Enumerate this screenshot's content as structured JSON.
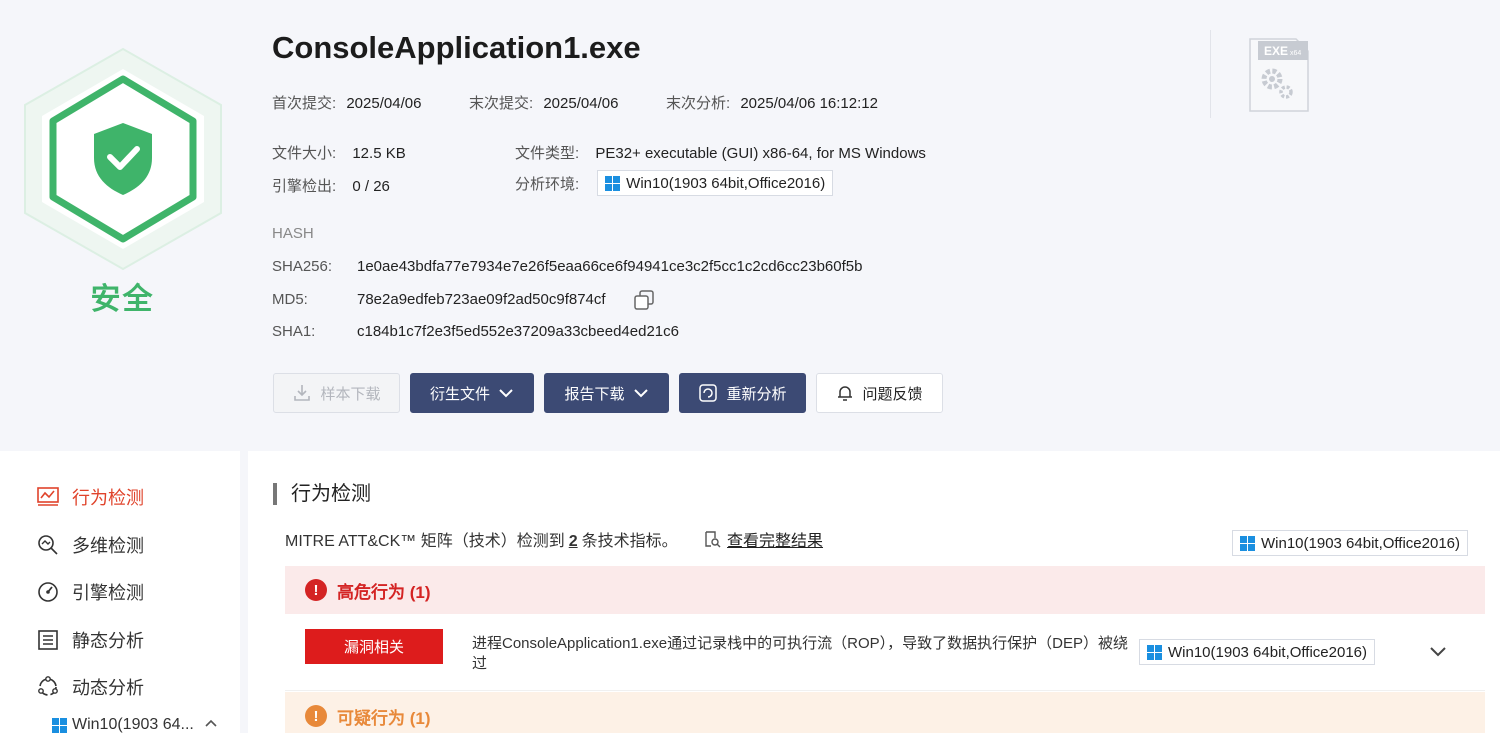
{
  "file": {
    "name": "ConsoleApplication1.exe",
    "verdict": "安全",
    "first_submit_label": "首次提交:",
    "first_submit": "2025/04/06",
    "last_submit_label": "末次提交:",
    "last_submit": "2025/04/06",
    "last_analysis_label": "末次分析:",
    "last_analysis": "2025/04/06 16:12:12",
    "size_label": "文件大小:",
    "size": "12.5 KB",
    "type_label": "文件类型:",
    "type": "PE32+ executable (GUI) x86-64, for MS Windows",
    "engines_label": "引擎检出:",
    "engines": "0 / 26",
    "env_label": "分析环境:",
    "env": "Win10(1903 64bit,Office2016)",
    "exe_badge": "EXE",
    "exe_arch": "x64"
  },
  "hash": {
    "title": "HASH",
    "sha256_label": "SHA256:",
    "sha256": "1e0ae43bdfa77e7934e7e26f5eaa66ce6f94941ce3c2f5cc1c2cd6cc23b60f5b",
    "md5_label": "MD5:",
    "md5": "78e2a9edfeb723ae09f2ad50c9f874cf",
    "sha1_label": "SHA1:",
    "sha1": "c184b1c7f2e3f5ed552e37209a33cbeed4ed21c6"
  },
  "actions": {
    "download_sample": "样本下载",
    "derived_files": "衍生文件",
    "report_download": "报告下载",
    "reanalyze": "重新分析",
    "feedback": "问题反馈"
  },
  "sidebar": {
    "items": [
      {
        "label": "行为检测",
        "icon": "monitor-chart-icon"
      },
      {
        "label": "多维检测",
        "icon": "multi-search-icon"
      },
      {
        "label": "引擎检测",
        "icon": "gauge-icon"
      },
      {
        "label": "静态分析",
        "icon": "list-doc-icon"
      },
      {
        "label": "动态分析",
        "icon": "cycle-icon"
      }
    ],
    "sub_item": "Win10(1903 64..."
  },
  "main": {
    "section_title": "行为检测",
    "mitre_prefix": "MITRE ATT&CK™ 矩阵（技术）检测到",
    "mitre_count": "2",
    "mitre_suffix": "条技术指标。",
    "full_result": "查看完整结果",
    "env": "Win10(1903 64bit,Office2016)",
    "high_risk": "高危行为 (1)",
    "suspicious": "可疑行为 (1)",
    "entry": {
      "tag": "漏洞相关",
      "text": "进程ConsoleApplication1.exe通过记录栈中的可执行流（ROP），导致了数据执行保护（DEP）被绕过",
      "env": "Win10(1903 64bit,Office2016)"
    }
  },
  "colors": {
    "safe_green": "#3fb46a",
    "dark_button": "#3c4a74",
    "danger_red": "#dd1c1c",
    "warning_orange": "#e8893a",
    "active_nav": "#e0432b"
  }
}
